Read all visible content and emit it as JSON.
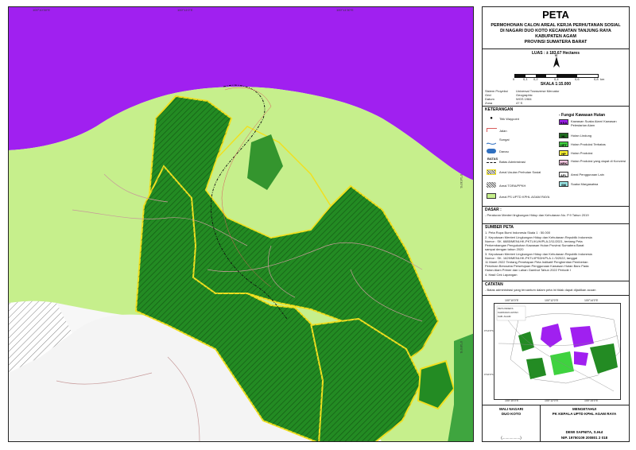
{
  "map": {
    "grid_top": [
      "100°10'30\"E",
      "100°11'0\"E",
      "100°11'30\"E"
    ],
    "grid_right": [
      "0°14'30\"S",
      "0°15'0\"S"
    ],
    "colors": {
      "kawasan_suaka_alam": "#a020f0",
      "hutan_lindung": "#238b23",
      "apl": "#c6ef8c",
      "boundary": "#f0e020",
      "river": "#c79a9a",
      "grey_area": "#f4f4f4"
    }
  },
  "panel": {
    "title": "PETA",
    "subtitle_lines": [
      "PERMOHONAN CALON AREAL KERJA PERHUTANAN SOSIAL",
      "DI NAGARI DUO KOTO KECAMATAN TANJUNG RAYA",
      "KABUPATEN AGAM",
      "PROVINSI SUMATERA BARAT"
    ],
    "luas": "LUAS : ± 183,67 Hectares",
    "north": "N",
    "scale_ticks": [
      "0",
      "0,1",
      "0,2",
      "0,4",
      "0,6",
      "0,8",
      "km"
    ],
    "skala": "SKALA   1:15.000",
    "projection": [
      [
        "Sistem Proyeksi",
        "Universal Transverse Mercator"
      ],
      [
        "Grid",
        "Geographic"
      ],
      [
        "Datum",
        "WGS 1984"
      ],
      [
        "Zona",
        "47 S"
      ]
    ],
    "keterangan_title": "KETERANGAN",
    "legend_left": [
      "Titik Waypoint",
      "Jalan",
      "Sungai",
      "Danau",
      "Batas Administrasi",
      "Areal Usulan Perhutan Sosial",
      "Areal TORA/PPKH",
      "Areal PS UPTD KPHL AGAM RAYA"
    ],
    "batas_tag": "BATAS",
    "fungsi_title": "- Fungsi Kawasan Hutan",
    "legend_right": [
      {
        "code": "KSA",
        "label": "Kawasan Suaka Alam/ Kawasan Pelestarian Alam",
        "color": "#a020f0"
      },
      {
        "code": "HL",
        "label": "Hutan Lindung",
        "color": "#1f6b1f"
      },
      {
        "code": "HPT",
        "label": "Hutan Produksi Terbatas",
        "color": "#3fd23f"
      },
      {
        "code": "HP",
        "label": "Hutan Produksi",
        "color": "#f5ee30"
      },
      {
        "code": "HPK",
        "label": "Hutan Produksi yang dapat di Konversi",
        "color": "#f5c6e0"
      },
      {
        "code": "APL",
        "label": "Areal Penggunaan Lain",
        "color": "#ffffff"
      },
      {
        "code": "SM",
        "label": "Suaka Margasatwa",
        "color": "#99e6e6"
      }
    ],
    "dasar_title": "DASAR :",
    "dasar_text": "- Peraturan Menteri lingkungan Hidup dan Kehutanan No. P.9 Tahun 2019",
    "sumber_title": "SUMBER PETA",
    "sumber_lines": [
      "1. Peta Rupa Bumi Indonesia Skala 1 : 50.000",
      "2. Keputusan Menteri Lingkungan Hidup dan Kehutanan Republik Indonesia",
      "   Nomor : SK. 6885/MENLHK-PKTL/KUH/PLA.2/11/2021, tentang Peta",
      "   Perkembangan Pengukuhan Kawasan Hutan Provinsi Sumatera Barat",
      "   sampai dengan tahun 2020",
      "3. Keputusan Menteri Lingkungan Hidup dan Kehutanan Republik Indonesia",
      "   Nomor : SK. 1629/MENLHK-PKTL/IPSDH/PLA.1 /3/2022, tanggal",
      "   11 Maret 2022 Tentang Penetapan Peta Indikatif Penghentian Pemberian",
      "   Perizinan Berusaha Persetujuan Penggunaan Kawasan Hutan Baru Pada",
      "   Hutan Alam Primer dan Lahan Gambut Tahun 2022 Periode I",
      "4. Hasil Cek Lapangan"
    ],
    "catatan_title": "CATATAN",
    "catatan_text": "- Batas administrasi yang tercantum dalam peta ini tidak dapat dijadikan acuan",
    "inset_grid_top": [
      "100°10'0\"E",
      "100°12'0\"E",
      "100°14'0\"E"
    ],
    "inset_grid_bottom": [
      "100°10'0\"E",
      "100°12'0\"E",
      "100°14'0\"E"
    ],
    "inset_grid_left": [
      "0°14'0\"S",
      "0°16'0\"S"
    ],
    "inset_label_lines": [
      "PETA INDEKS",
      "KAWASAN HUTAN",
      "KAB. AGAM"
    ],
    "wali_title_lines": [
      "WALI NAGARI",
      "DUO KOTO"
    ],
    "mengetahui_lines": [
      "MENGETAHUI",
      "PK KEPALA UPTD KPHL AGAM RAYA"
    ],
    "wali_sign": "(..................)",
    "officer_name": "DEWI SAPNITA, S.Hut",
    "officer_nip": "NIP. 19750109 200801 2 018"
  }
}
